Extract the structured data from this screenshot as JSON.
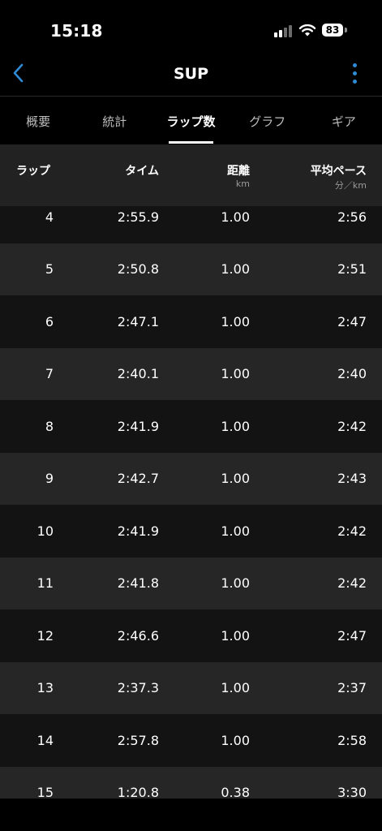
{
  "status_bar": {
    "time": "15:18",
    "battery": "83"
  },
  "navbar": {
    "title": "SUP"
  },
  "tabs": [
    {
      "label": "概要",
      "active": false
    },
    {
      "label": "統計",
      "active": false
    },
    {
      "label": "ラップ数",
      "active": true
    },
    {
      "label": "グラフ",
      "active": false
    },
    {
      "label": "ギア",
      "active": false
    }
  ],
  "table": {
    "headers": {
      "lap": "ラップ",
      "time": "タイム",
      "distance": "距離",
      "distance_unit": "km",
      "pace": "平均ペース",
      "pace_unit": "分／km"
    },
    "rows": [
      {
        "lap": "4",
        "time": "2:55.9",
        "distance": "1.00",
        "pace": "2:56"
      },
      {
        "lap": "5",
        "time": "2:50.8",
        "distance": "1.00",
        "pace": "2:51"
      },
      {
        "lap": "6",
        "time": "2:47.1",
        "distance": "1.00",
        "pace": "2:47"
      },
      {
        "lap": "7",
        "time": "2:40.1",
        "distance": "1.00",
        "pace": "2:40"
      },
      {
        "lap": "8",
        "time": "2:41.9",
        "distance": "1.00",
        "pace": "2:42"
      },
      {
        "lap": "9",
        "time": "2:42.7",
        "distance": "1.00",
        "pace": "2:43"
      },
      {
        "lap": "10",
        "time": "2:41.9",
        "distance": "1.00",
        "pace": "2:42"
      },
      {
        "lap": "11",
        "time": "2:41.8",
        "distance": "1.00",
        "pace": "2:42"
      },
      {
        "lap": "12",
        "time": "2:46.6",
        "distance": "1.00",
        "pace": "2:47"
      },
      {
        "lap": "13",
        "time": "2:37.3",
        "distance": "1.00",
        "pace": "2:37"
      },
      {
        "lap": "14",
        "time": "2:57.8",
        "distance": "1.00",
        "pace": "2:58"
      },
      {
        "lap": "15",
        "time": "1:20.8",
        "distance": "0.38",
        "pace": "3:30"
      }
    ]
  },
  "icons": {
    "back": "chevron-left-icon",
    "more": "more-vertical-icon",
    "signal": "cellular-signal-icon",
    "wifi": "wifi-icon",
    "battery": "battery-icon"
  },
  "colors": {
    "accent": "#2e8bd6",
    "background": "#000000",
    "row_dark": "#131313",
    "row_light": "#262626",
    "header_bg": "#222222"
  }
}
